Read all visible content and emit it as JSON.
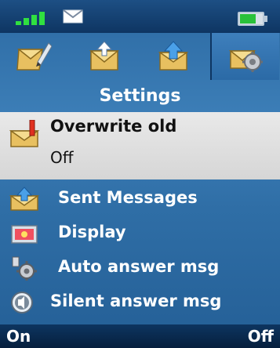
{
  "status_bar": {
    "signal_icon": "signal-bars-icon",
    "message_icon": "envelope-icon",
    "battery_icon": "battery-icon",
    "battery_level": 0.7,
    "signal_color": "#30e040",
    "battery_color": "#29c13a"
  },
  "tabs": [
    {
      "icon": "write-message-icon",
      "active": false
    },
    {
      "icon": "inbox-icon",
      "active": false
    },
    {
      "icon": "outbox-icon",
      "active": false
    },
    {
      "icon": "settings-icon",
      "active": true
    }
  ],
  "title": "Settings",
  "selected_item": {
    "label": "Overwrite old",
    "value": "Off",
    "icon": "overwrite-icon"
  },
  "menu_items": [
    {
      "label": "Sent Messages",
      "icon": "sent-messages-icon"
    },
    {
      "label": "Display",
      "icon": "display-icon"
    },
    {
      "label": "Auto answer msg",
      "icon": "auto-answer-icon"
    },
    {
      "label": "Silent answer msg",
      "icon": "silent-answer-icon"
    }
  ],
  "softkeys": {
    "left": "On",
    "right": "Off"
  },
  "colors": {
    "background": "#2f6ea6",
    "selection_bg": "#e0e0e0",
    "bar_dark": "#0e3562"
  }
}
